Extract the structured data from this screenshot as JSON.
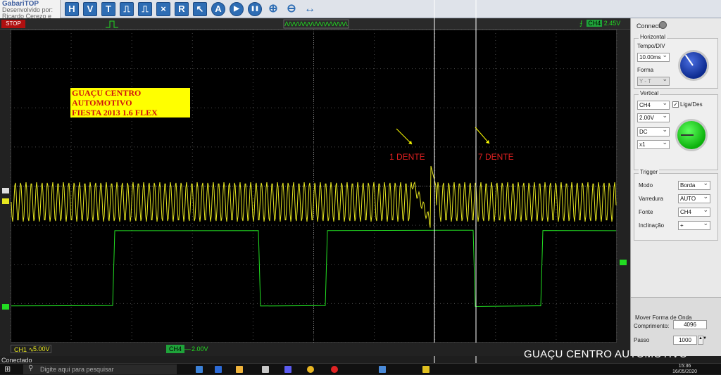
{
  "toolbar": {
    "logo_title": "GabariTOP",
    "logo_lines": [
      "Desenvolvido por:",
      "Ricardo Cerezo e Mauro Cerezo"
    ],
    "buttons": [
      {
        "icon": "h-icon",
        "label": "H"
      },
      {
        "icon": "v-icon",
        "label": "V"
      },
      {
        "icon": "t-icon",
        "label": "T"
      },
      {
        "icon": "pulse-up-icon",
        "label": "⎍"
      },
      {
        "icon": "pulse-down-icon",
        "label": "⎍"
      },
      {
        "icon": "x10-icon",
        "label": "×"
      },
      {
        "icon": "reset-icon",
        "label": "R"
      },
      {
        "icon": "arrow-icon",
        "label": "↖"
      },
      {
        "icon": "auto-icon",
        "label": "A"
      },
      {
        "icon": "play-icon",
        "label": "▶"
      },
      {
        "icon": "pause-icon",
        "label": "❚❚"
      },
      {
        "icon": "zoom-in-icon",
        "label": "⊕"
      },
      {
        "icon": "zoom-out-icon",
        "label": "⊖"
      },
      {
        "icon": "fit-icon",
        "label": "↔"
      }
    ]
  },
  "status": {
    "stop_label": "STOP",
    "trigger_channel": "CH4",
    "trigger_level": "2.45V"
  },
  "overlay": {
    "title_line1": "GUAÇU CENTRO AUTOMOTIVO",
    "title_line2": " FIESTA 2013 1.6 FLEX",
    "label_1": "1 DENTE",
    "label_7": "7 DENTE",
    "watermark": "GUAÇU CENTRO AUTOMOTIVO"
  },
  "channels": {
    "ch1_label": "CH1",
    "ch1_coupling": "∿",
    "ch1_value": "5.00V",
    "ch4_label": "CH4",
    "ch4_coupling": "—",
    "ch4_value": "2.00V",
    "ch1_color": "#e8e820",
    "ch4_color": "#22dd22"
  },
  "panel": {
    "connect_label": "Connect",
    "horizontal": {
      "title": "Horizontal",
      "tempo_label": "Tempo/DIV",
      "tempo_value": "10.00ms",
      "forma_label": "Forma",
      "forma_value": "Y - T"
    },
    "vertical": {
      "title": "Vertical",
      "channel_value": "CH4",
      "ligades_label": "Liga/Des",
      "volts_value": "2.00V",
      "coupling_value": "DC",
      "probe_value": "x1"
    },
    "trigger": {
      "title": "Trigger",
      "modo_label": "Modo",
      "modo_value": "Borda",
      "varredura_label": "Varredura",
      "varredura_value": "AUTO",
      "fonte_label": "Fonte",
      "fonte_value": "CH4",
      "inclinacao_label": "Inclinação",
      "inclinacao_value": "+"
    },
    "mover": {
      "title": "Mover Forma de Onda",
      "comprimento_label": "Comprimento:",
      "comprimento_value": "4096",
      "passo_label": "Passo",
      "passo_value": "1000"
    }
  },
  "footer": {
    "connected_label": "Conectado",
    "search_placeholder": "Digite aqui para pesquisar",
    "clock_time": "15:36",
    "clock_date": "16/05/2020"
  }
}
